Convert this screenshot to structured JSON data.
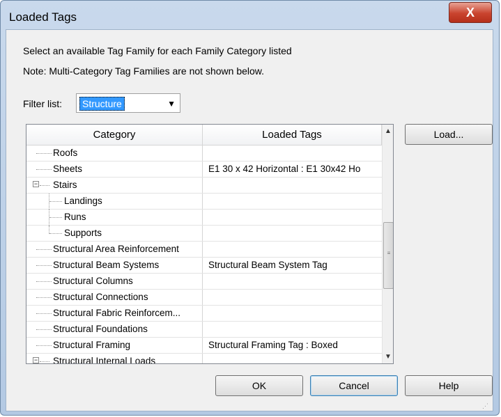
{
  "window": {
    "title": "Loaded Tags",
    "close_label": "X"
  },
  "instructions": {
    "line1": "Select an available Tag Family for each Family Category listed",
    "line2": "Note: Multi-Category Tag Families are not shown below."
  },
  "filter": {
    "label": "Filter list:",
    "value": "Structure"
  },
  "grid": {
    "headers": {
      "category": "Category",
      "loaded_tags": "Loaded Tags"
    },
    "rows": [
      {
        "category": "Roofs",
        "tag": ""
      },
      {
        "category": "Sheets",
        "tag": "E1 30 x 42 Horizontal : E1 30x42 Ho"
      },
      {
        "category": "Stairs",
        "tag": "",
        "expander": "−"
      },
      {
        "category": "Landings",
        "tag": ""
      },
      {
        "category": "Runs",
        "tag": ""
      },
      {
        "category": "Supports",
        "tag": ""
      },
      {
        "category": "Structural Area Reinforcement",
        "tag": ""
      },
      {
        "category": "Structural Beam Systems",
        "tag": "Structural Beam System Tag"
      },
      {
        "category": "Structural Columns",
        "tag": ""
      },
      {
        "category": "Structural Connections",
        "tag": ""
      },
      {
        "category": "Structural Fabric Reinforcem...",
        "tag": ""
      },
      {
        "category": "Structural Foundations",
        "tag": ""
      },
      {
        "category": "Structural Framing",
        "tag": "Structural Framing Tag : Boxed"
      },
      {
        "category": "Structural Internal Loads",
        "tag": "",
        "expander": "−"
      }
    ]
  },
  "buttons": {
    "load": "Load...",
    "ok": "OK",
    "cancel": "Cancel",
    "help": "Help"
  }
}
